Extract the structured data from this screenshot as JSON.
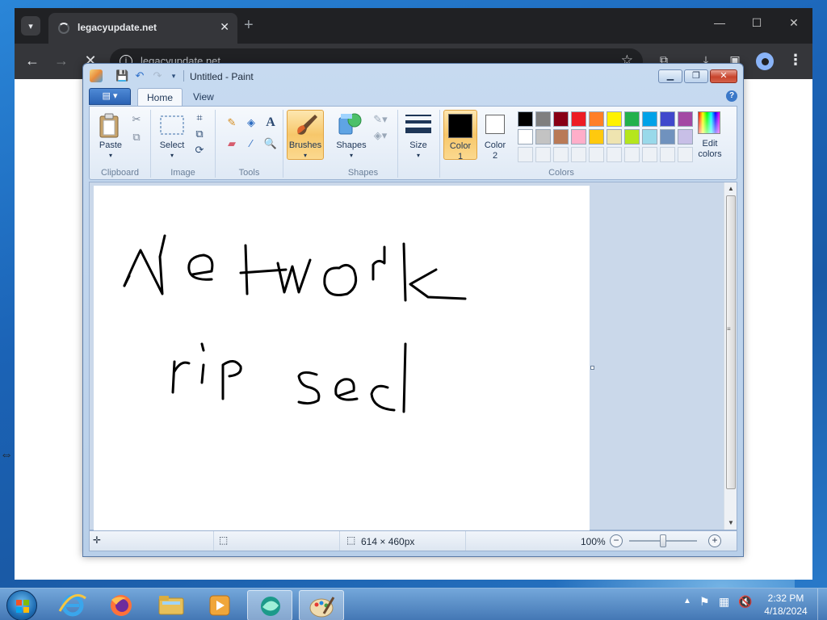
{
  "browser": {
    "tab_title": "legacyupdate.net",
    "tab_close": "✕",
    "new_tab": "+",
    "url": "legacyupdate.net",
    "win_minimize": "—",
    "win_maximize": "☐",
    "win_close": "✕"
  },
  "paint": {
    "title": "Untitled - Paint",
    "tabs": [
      "Home",
      "View"
    ],
    "groups": {
      "clipboard": {
        "label": "Clipboard",
        "paste": "Paste"
      },
      "image": {
        "label": "Image",
        "select": "Select"
      },
      "tools": {
        "label": "Tools"
      },
      "brushes": {
        "label": "Brushes"
      },
      "shapes": {
        "label": "Shapes",
        "shapes": "Shapes"
      },
      "size": {
        "label": "Size"
      },
      "colors": {
        "label": "Colors",
        "color1": "Color\n1",
        "color2": "Color\n2",
        "edit_colors": "Edit\ncolors"
      }
    },
    "color1_value": "#000000",
    "color2_value": "#ffffff",
    "palette_row1": [
      "#000000",
      "#7f7f7f",
      "#880015",
      "#ed1c24",
      "#ff7f27",
      "#fff200",
      "#22b14c",
      "#00a2e8",
      "#3f48cc",
      "#a349a4"
    ],
    "palette_row2": [
      "#ffffff",
      "#c3c3c3",
      "#b97a57",
      "#ffaec9",
      "#ffc90e",
      "#efe4b0",
      "#b5e61d",
      "#99d9ea",
      "#7092be",
      "#c8bfe7"
    ],
    "palette_row3_empty": 10,
    "canvas_handwriting": [
      "Network",
      "rip sec!"
    ],
    "status": {
      "canvas_size": "614 × 460px",
      "zoom": "100%"
    }
  },
  "taskbar": {
    "time": "2:32 PM",
    "date": "4/18/2024"
  }
}
